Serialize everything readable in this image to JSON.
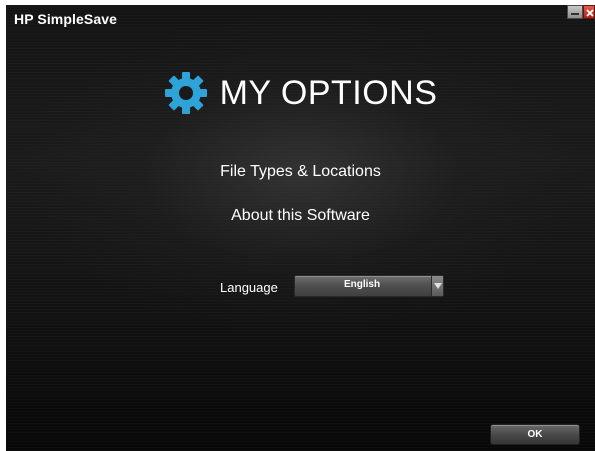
{
  "window": {
    "title": "HP SimpleSave"
  },
  "header": {
    "title": "MY OPTIONS",
    "icon": "gear-icon",
    "icon_color": "#2ea3d8"
  },
  "menu": {
    "file_types_label": "File Types & Locations",
    "about_label": "About this Software"
  },
  "language": {
    "label": "Language",
    "selected": "English"
  },
  "footer": {
    "ok_label": "OK"
  },
  "colors": {
    "background": "#141414",
    "text": "#ffffff",
    "close_button": "#c8362a"
  }
}
